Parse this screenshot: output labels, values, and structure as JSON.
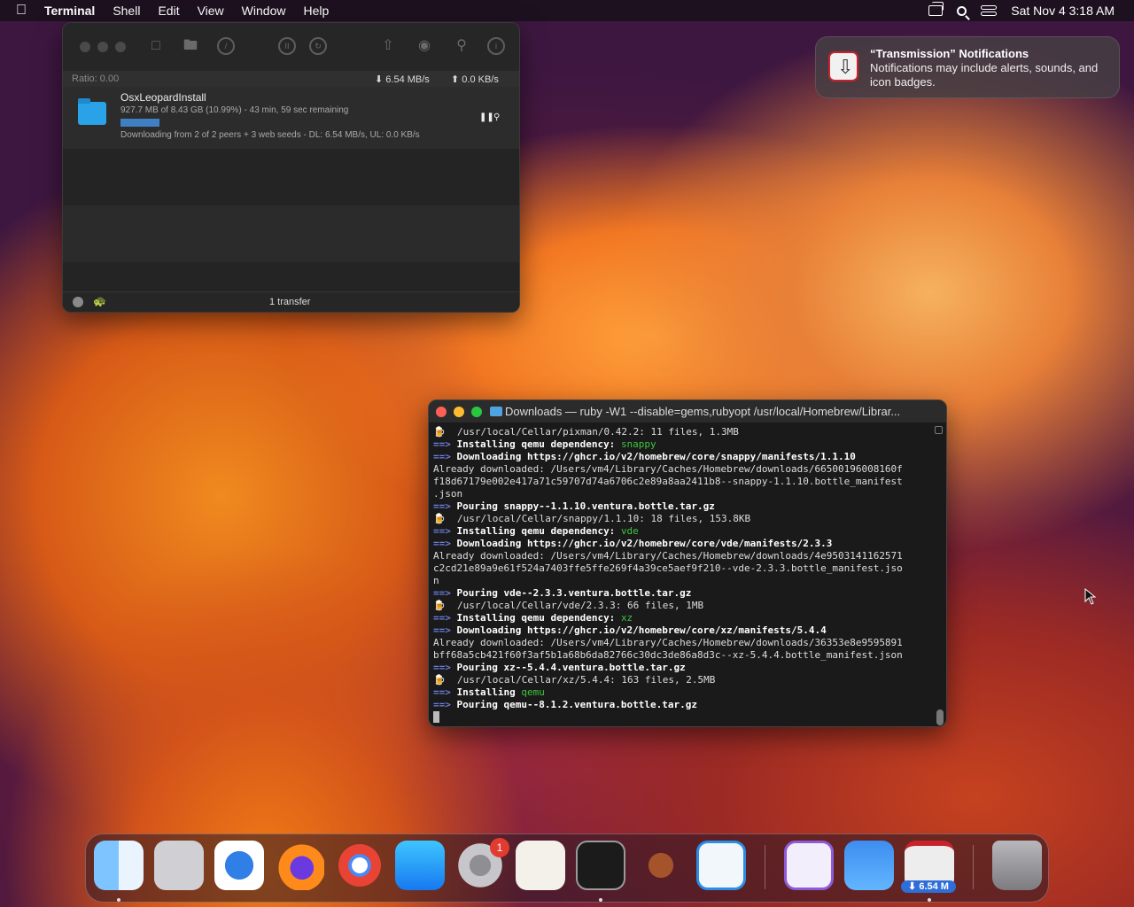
{
  "menubar": {
    "apple": "",
    "app": "Terminal",
    "items": [
      "Shell",
      "Edit",
      "View",
      "Window",
      "Help"
    ],
    "clock": "Sat Nov 4  3:18 AM"
  },
  "transmission": {
    "ratio": "Ratio: 0.00",
    "download_rate": "6.54 MB/s",
    "upload_rate": "0.0 KB/s",
    "torrent": {
      "name": "OsxLeopardInstall",
      "progress_text": "927.7 MB of 8.43 GB (10.99%) - 43 min, 59 sec remaining",
      "progress": 0.1099,
      "status": "Downloading from 2 of 2 peers + 3 web seeds - DL: 6.54 MB/s, UL: 0.0 KB/s",
      "pause_icon": "pause-icon",
      "reveal_icon": "magnifier-icon"
    },
    "footer": "1 transfer"
  },
  "notification": {
    "title": "“Transmission” Notifications",
    "body": "Notifications may include alerts, sounds, and icon badges."
  },
  "terminal": {
    "title": "Downloads — ruby -W1 --disable=gems,rubyopt /usr/local/Homebrew/Librar...",
    "lines": [
      {
        "prefix": "🍺  ",
        "text": "/usr/local/Cellar/pixman/0.42.2: 11 files, 1.3MB",
        "style": "plain"
      },
      {
        "prefix": "==> ",
        "text": "Installing qemu dependency: ",
        "extra": "snappy",
        "style": "bold"
      },
      {
        "prefix": "==> ",
        "text": "Downloading https://ghcr.io/v2/homebrew/core/snappy/manifests/1.1.10",
        "style": "bold"
      },
      {
        "prefix": "",
        "text": "Already downloaded: /Users/vm4/Library/Caches/Homebrew/downloads/66500196008160f",
        "style": "plain"
      },
      {
        "prefix": "",
        "text": "f18d67179e002e417a71c59707d74a6706c2e89a8aa2411b8--snappy-1.1.10.bottle_manifest",
        "style": "plain"
      },
      {
        "prefix": "",
        "text": ".json",
        "style": "plain"
      },
      {
        "prefix": "==> ",
        "text": "Pouring snappy--1.1.10.ventura.bottle.tar.gz",
        "style": "bold"
      },
      {
        "prefix": "🍺  ",
        "text": "/usr/local/Cellar/snappy/1.1.10: 18 files, 153.8KB",
        "style": "plain"
      },
      {
        "prefix": "==> ",
        "text": "Installing qemu dependency: ",
        "extra": "vde",
        "style": "bold"
      },
      {
        "prefix": "==> ",
        "text": "Downloading https://ghcr.io/v2/homebrew/core/vde/manifests/2.3.3",
        "style": "bold"
      },
      {
        "prefix": "",
        "text": "Already downloaded: /Users/vm4/Library/Caches/Homebrew/downloads/4e9503141162571",
        "style": "plain"
      },
      {
        "prefix": "",
        "text": "c2cd21e89a9e61f524a7403ffe5ffe269f4a39ce5aef9f210--vde-2.3.3.bottle_manifest.jso",
        "style": "plain"
      },
      {
        "prefix": "",
        "text": "n",
        "style": "plain"
      },
      {
        "prefix": "==> ",
        "text": "Pouring vde--2.3.3.ventura.bottle.tar.gz",
        "style": "bold"
      },
      {
        "prefix": "🍺  ",
        "text": "/usr/local/Cellar/vde/2.3.3: 66 files, 1MB",
        "style": "plain"
      },
      {
        "prefix": "==> ",
        "text": "Installing qemu dependency: ",
        "extra": "xz",
        "style": "bold"
      },
      {
        "prefix": "==> ",
        "text": "Downloading https://ghcr.io/v2/homebrew/core/xz/manifests/5.4.4",
        "style": "bold"
      },
      {
        "prefix": "",
        "text": "Already downloaded: /Users/vm4/Library/Caches/Homebrew/downloads/36353e8e9595891",
        "style": "plain"
      },
      {
        "prefix": "",
        "text": "bff68a5cb421f60f3af5b1a68b6da82766c30dc3de86a8d3c--xz-5.4.4.bottle_manifest.json",
        "style": "plain"
      },
      {
        "prefix": "==> ",
        "text": "Pouring xz--5.4.4.ventura.bottle.tar.gz",
        "style": "bold"
      },
      {
        "prefix": "🍺  ",
        "text": "/usr/local/Cellar/xz/5.4.4: 163 files, 2.5MB",
        "style": "plain"
      },
      {
        "prefix": "==> ",
        "text": "Installing ",
        "extra": "qemu",
        "style": "bold"
      },
      {
        "prefix": "==> ",
        "text": "Pouring qemu--8.1.2.ventura.bottle.tar.gz",
        "style": "bold"
      }
    ]
  },
  "dock": {
    "apps": [
      "Finder",
      "Launchpad",
      "Safari",
      "Firefox",
      "Chrome",
      "App Store",
      "System Settings",
      "TextEdit",
      "Terminal",
      "Instruments",
      "Visual Studio Code",
      "Visual Studio",
      "Weather",
      "Transmission",
      "Trash"
    ],
    "settings_badge": "1",
    "transmission_badge": "⬇ 6.54 M"
  },
  "colors": {
    "accent_blue": "#3f7fc4",
    "prompt_arrow": "#6b7de0",
    "dep_green": "#3fc43f",
    "badge_red": "#e23c31"
  }
}
